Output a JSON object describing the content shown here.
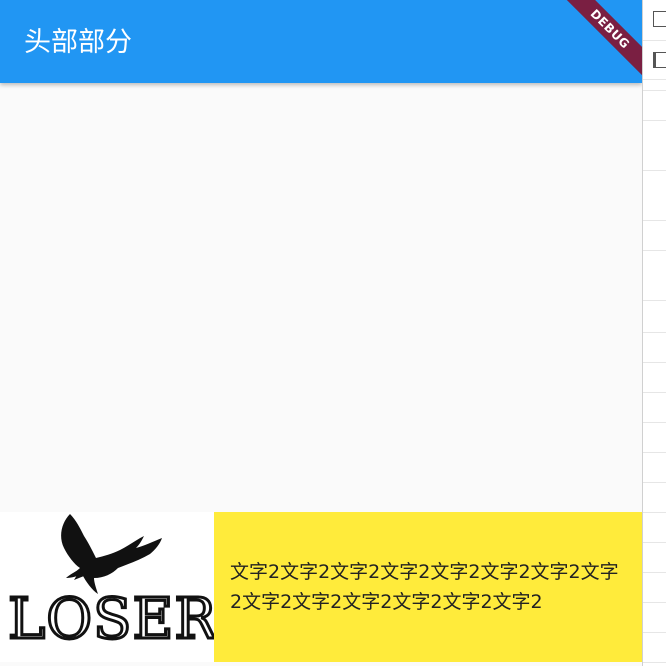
{
  "appbar": {
    "title": "头部部分",
    "debug_banner": "DEBUG",
    "color": "#2196f3"
  },
  "debug_banner_color": "#7a1f42",
  "bottom": {
    "logo": {
      "icon": "eagle-icon",
      "text": "LOSER"
    },
    "text": "文字2文字2文字2文字2文字2文字2文字2文字2文字2文字2文字2文字2文字2文字2",
    "text_background": "#ffeb3b"
  },
  "side_panel": {
    "icons": [
      "file-icon",
      "panel-icon"
    ]
  }
}
